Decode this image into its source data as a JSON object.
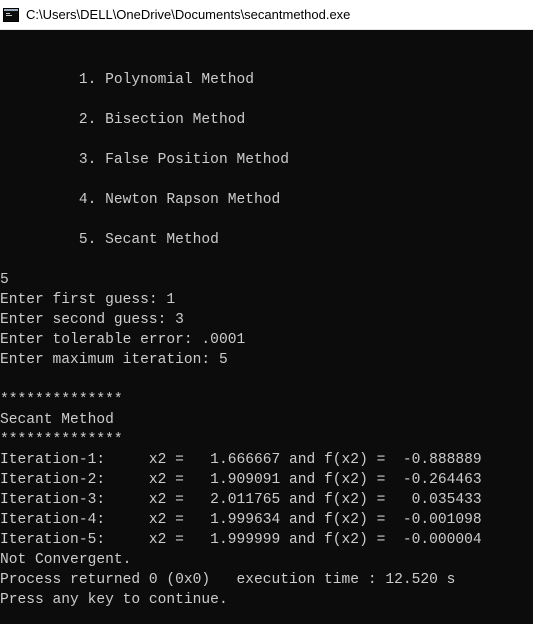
{
  "window": {
    "title": "C:\\Users\\DELL\\OneDrive\\Documents\\secantmethod.exe",
    "icon": "console-app-icon"
  },
  "console": {
    "menu": [
      "         1. Polynomial Method",
      "         2. Bisection Method",
      "         3. False Position Method",
      "         4. Newton Rapson Method",
      "         5. Secant Method"
    ],
    "choice": "5",
    "prompts": [
      "Enter first guess: 1",
      "Enter second guess: 3",
      "Enter tolerable error: .0001",
      "Enter maximum iteration: 5"
    ],
    "separator_top": "**************",
    "method_title": "Secant Method",
    "separator_bottom": "**************",
    "iterations": [
      "Iteration-1:     x2 =   1.666667 and f(x2) =  -0.888889",
      "Iteration-2:     x2 =   1.909091 and f(x2) =  -0.264463",
      "Iteration-3:     x2 =   2.011765 and f(x2) =   0.035433",
      "Iteration-4:     x2 =   1.999634 and f(x2) =  -0.001098",
      "Iteration-5:     x2 =   1.999999 and f(x2) =  -0.000004"
    ],
    "result": "Not Convergent.",
    "process_status": "Process returned 0 (0x0)   execution time : 12.520 s",
    "continue_prompt": "Press any key to continue."
  },
  "colors": {
    "console_bg": "#0c0c0c",
    "console_text": "#cccccc",
    "titlebar_bg": "#ffffff"
  }
}
